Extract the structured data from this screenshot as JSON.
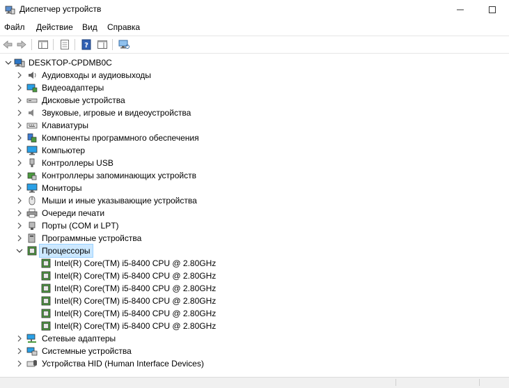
{
  "window": {
    "title": "Диспетчер устройств"
  },
  "menu": [
    "Файл",
    "Действие",
    "Вид",
    "Справка"
  ],
  "tree": {
    "root": "DESKTOP-CPDMB0C",
    "categories": [
      {
        "label": "Аудиовходы и аудиовыходы",
        "icon": "speaker-icon"
      },
      {
        "label": "Видеоадаптеры",
        "icon": "display-adapter-icon"
      },
      {
        "label": "Дисковые устройства",
        "icon": "disk-drive-icon"
      },
      {
        "label": "Звуковые, игровые и видеоустройства",
        "icon": "sound-icon"
      },
      {
        "label": "Клавиатуры",
        "icon": "keyboard-icon"
      },
      {
        "label": "Компоненты программного обеспечения",
        "icon": "software-component-icon"
      },
      {
        "label": "Компьютер",
        "icon": "computer-icon"
      },
      {
        "label": "Контроллеры USB",
        "icon": "usb-icon"
      },
      {
        "label": "Контроллеры запоминающих устройств",
        "icon": "storage-controller-icon"
      },
      {
        "label": "Мониторы",
        "icon": "monitor-icon"
      },
      {
        "label": "Мыши и иные указывающие устройства",
        "icon": "mouse-icon"
      },
      {
        "label": "Очереди печати",
        "icon": "printer-icon"
      },
      {
        "label": "Порты (COM и LPT)",
        "icon": "port-icon"
      },
      {
        "label": "Программные устройства",
        "icon": "software-device-icon"
      },
      {
        "label": "Процессоры",
        "icon": "processor-icon"
      },
      {
        "label": "Сетевые адаптеры",
        "icon": "network-adapter-icon"
      },
      {
        "label": "Системные устройства",
        "icon": "system-device-icon"
      },
      {
        "label": "Устройства HID (Human Interface Devices)",
        "icon": "hid-icon"
      }
    ],
    "processors": [
      "Intel(R) Core(TM) i5-8400 CPU @ 2.80GHz",
      "Intel(R) Core(TM) i5-8400 CPU @ 2.80GHz",
      "Intel(R) Core(TM) i5-8400 CPU @ 2.80GHz",
      "Intel(R) Core(TM) i5-8400 CPU @ 2.80GHz",
      "Intel(R) Core(TM) i5-8400 CPU @ 2.80GHz",
      "Intel(R) Core(TM) i5-8400 CPU @ 2.80GHz"
    ]
  },
  "colors": {
    "selection": "#cce8ff",
    "accent": "#0078d7"
  }
}
